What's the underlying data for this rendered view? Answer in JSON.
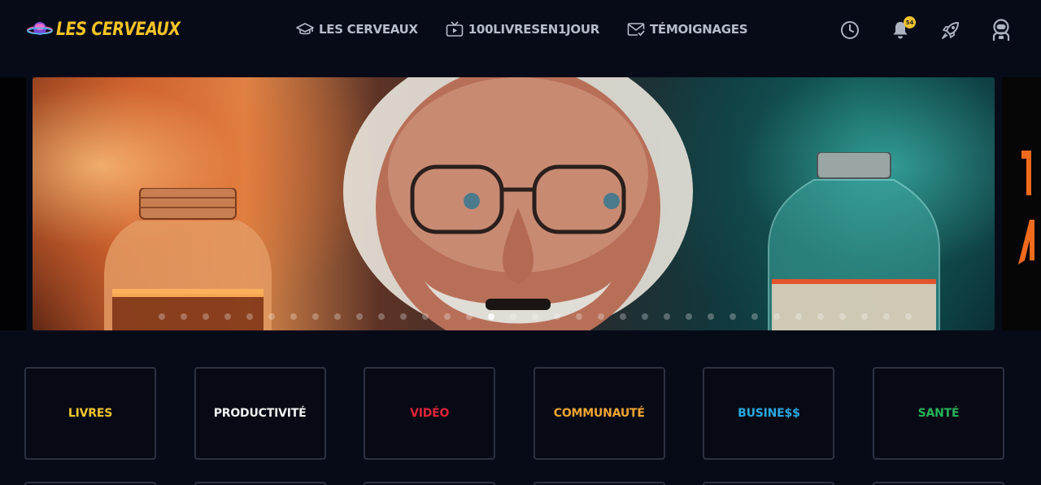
{
  "header": {
    "logo_text": "LES CERVEAUX",
    "nav": [
      {
        "label": "LES CERVEAUX",
        "icon": "graduation-cap-icon"
      },
      {
        "label": "100LIVRESEN1JOUR",
        "icon": "tv-play-icon"
      },
      {
        "label": "TÉMOIGNAGES",
        "icon": "mail-check-icon"
      }
    ],
    "actions": [
      {
        "icon": "clock-icon"
      },
      {
        "icon": "bell-icon",
        "badge": "54"
      },
      {
        "icon": "rocket-icon"
      },
      {
        "icon": "astronaut-avatar-icon"
      }
    ]
  },
  "carousel": {
    "slide_count": 35,
    "active_index": 15
  },
  "categories": [
    {
      "label": "LIVRES",
      "color": "#f3c52d"
    },
    {
      "label": "PRODUCTIVITÉ",
      "color": "#f1f1f1"
    },
    {
      "label": "VIDÉO",
      "color": "#e0243a"
    },
    {
      "label": "COMMUNAUTÉ",
      "color": "#f2a531"
    },
    {
      "label": "BUSINE$$",
      "color": "#2aa8e0"
    },
    {
      "label": "SANTÉ",
      "color": "#27b35a"
    }
  ],
  "colors": {
    "background": "#070b18",
    "accent": "#f6c324",
    "nav_text": "#b7bccb"
  }
}
